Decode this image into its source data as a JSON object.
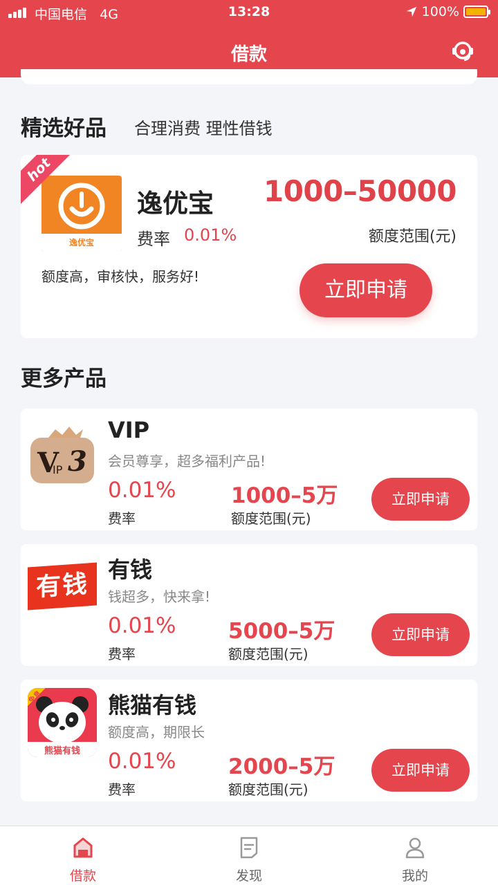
{
  "status_bar": {
    "carrier": "中国电信",
    "network": "4G",
    "time": "13:28",
    "battery": "100%"
  },
  "header": {
    "title": "借款",
    "support_icon": "customer-service-icon"
  },
  "featured_section": {
    "title": "精选好品",
    "subtitle": "合理消费 理性借钱"
  },
  "featured": {
    "badge": "hot",
    "logo_caption": "逸优宝",
    "name": "逸优宝",
    "rate_label": "费率",
    "rate": "0.01%",
    "amount": "1000–50000",
    "amount_label": "额度范围(元)",
    "description": "额度高，审核快，服务好!",
    "apply_label": "立即申请"
  },
  "more_section": {
    "title": "更多产品"
  },
  "products": [
    {
      "logo": "vip3-crown-logo",
      "name": "VIP",
      "description": "会员尊享，超多福利产品!",
      "rate": "0.01%",
      "rate_label": "费率",
      "amount": "1000–5万",
      "amount_label": "额度范围(元)",
      "apply_label": "立即申请"
    },
    {
      "logo": "youqian-logo",
      "logo_text": "有钱",
      "name": "有钱",
      "description": "钱超多，快来拿!",
      "rate": "0.01%",
      "rate_label": "费率",
      "amount": "5000–5万",
      "amount_label": "额度范围(元)",
      "apply_label": "立即申请"
    },
    {
      "logo": "panda-logo",
      "logo_text": "熊猫有钱",
      "logo_badge": "免息",
      "name": "熊猫有钱",
      "description": "额度高，期限长",
      "rate": "0.01%",
      "rate_label": "费率",
      "amount": "2000–5万",
      "amount_label": "额度范围(元)",
      "apply_label": "立即申请"
    }
  ],
  "tabbar": [
    {
      "label": "借款",
      "icon": "home-icon",
      "active": true
    },
    {
      "label": "发现",
      "icon": "document-icon",
      "active": false
    },
    {
      "label": "我的",
      "icon": "user-icon",
      "active": false
    }
  ],
  "colors": {
    "brand": "#e5454d",
    "background": "#f4f5f8"
  }
}
